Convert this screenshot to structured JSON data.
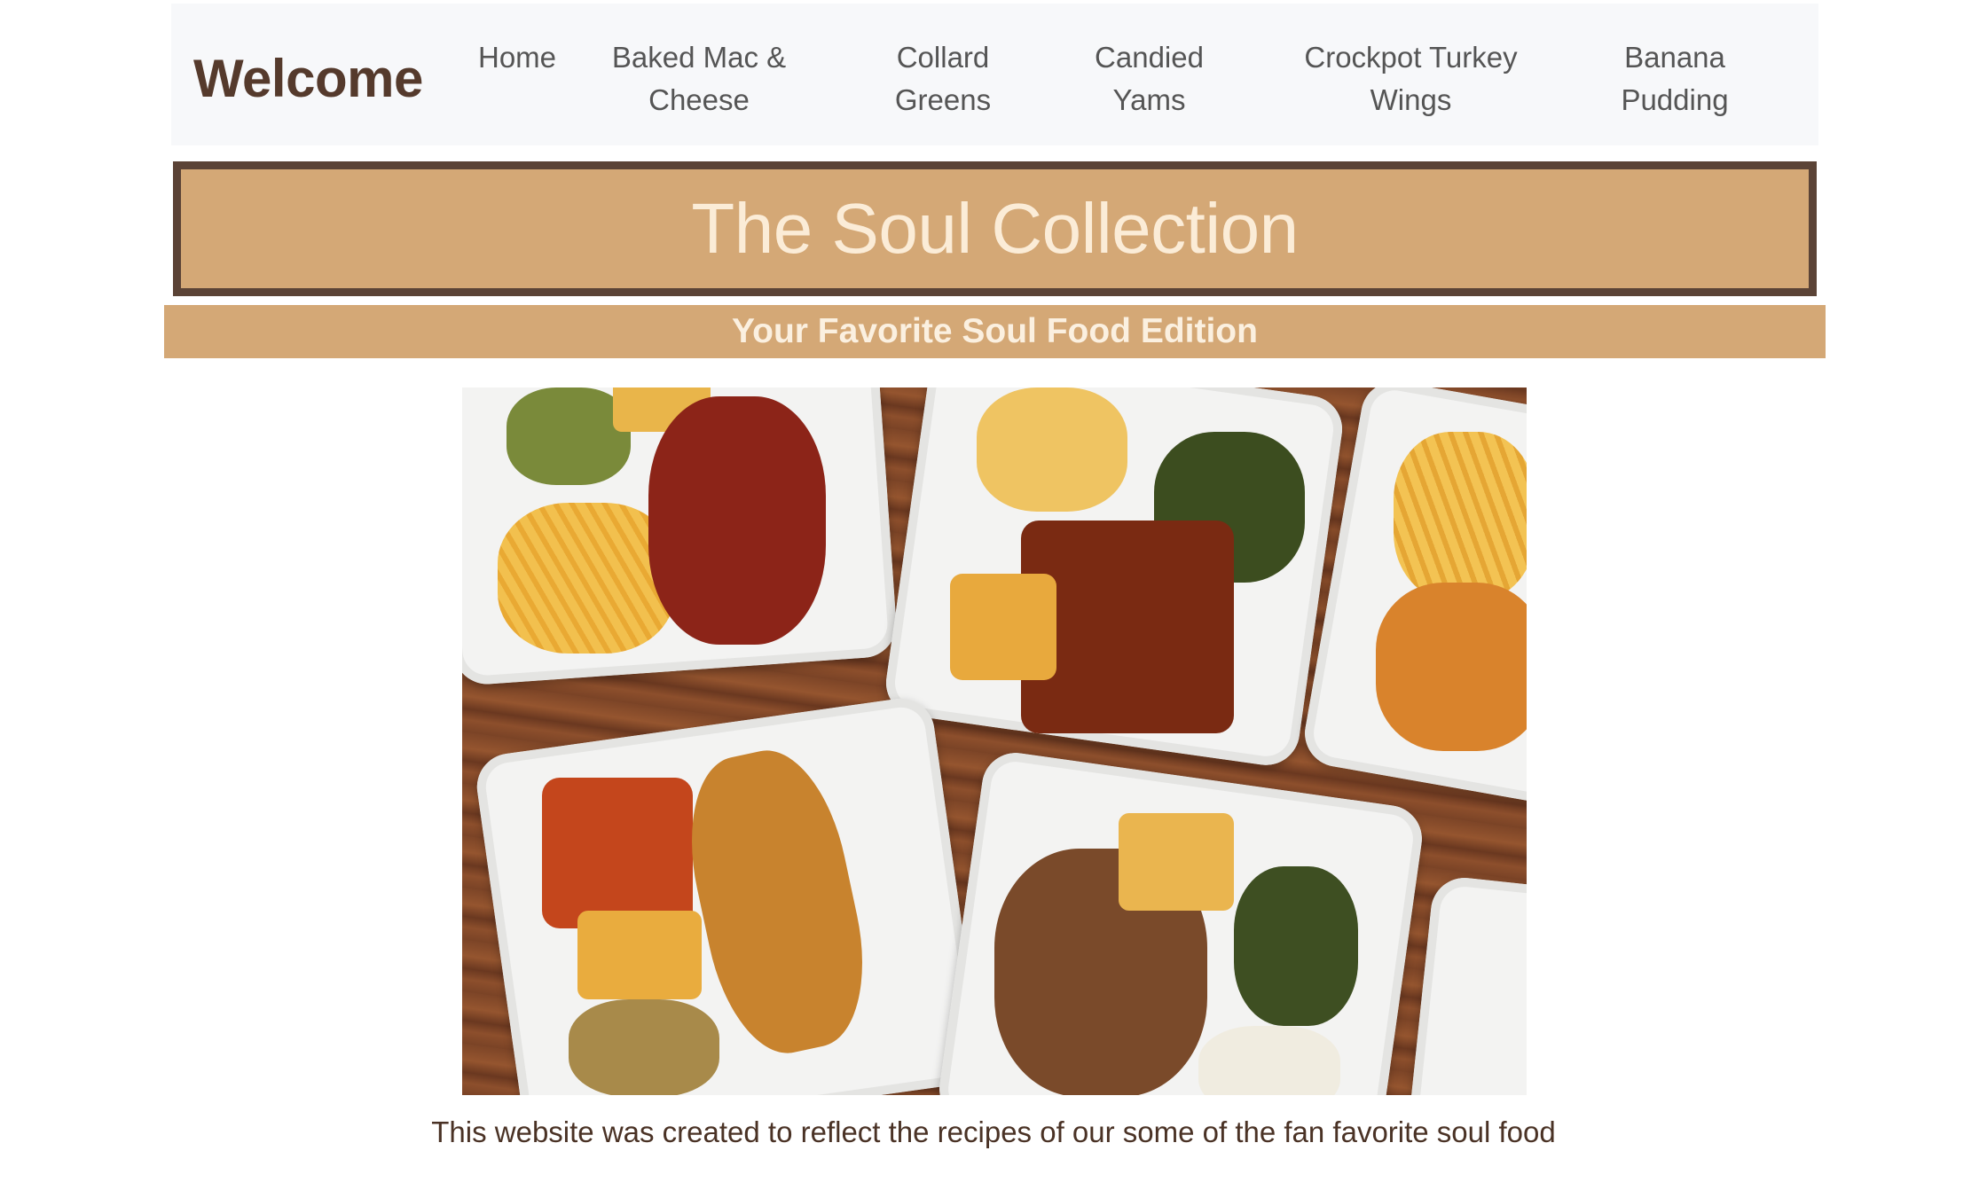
{
  "navbar": {
    "brand": "Welcome",
    "items": [
      {
        "label": "Home"
      },
      {
        "label": "Baked Mac & Cheese"
      },
      {
        "label": "Collard Greens"
      },
      {
        "label": "Candied Yams"
      },
      {
        "label": "Crockpot Turkey Wings"
      },
      {
        "label": "Banana Pudding"
      }
    ]
  },
  "banner": {
    "title": "The Soul Collection",
    "subtitle": "Your Favorite Soul Food Edition"
  },
  "hero": {
    "alt": "Soul food plates in takeout trays"
  },
  "caption": "This website was created to reflect the recipes of our some of the fan favorite soul food",
  "colors": {
    "banner_bg": "#d4a876",
    "banner_border": "#5b4336",
    "brand": "#553a2c",
    "navbar_bg": "#f7f8fa"
  }
}
